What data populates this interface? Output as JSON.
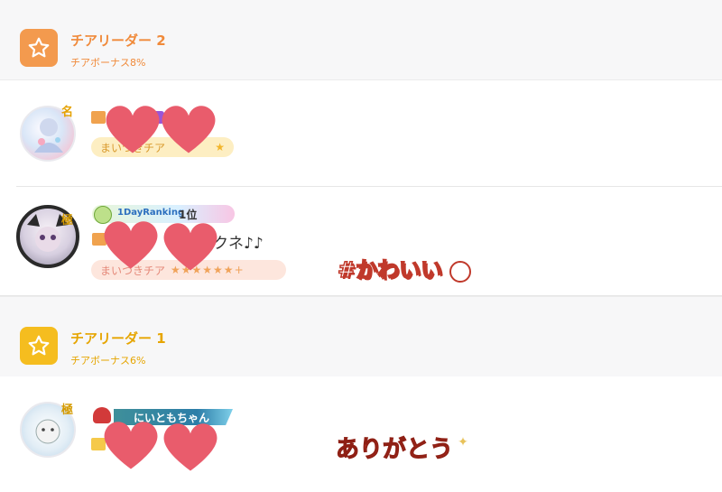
{
  "colors": {
    "tier2_accent": "#f39a4e",
    "tier1_accent": "#f5bd1f",
    "heart": "#e95c6c",
    "sticker_red": "#c0392b"
  },
  "section_tier2": {
    "title": "チアリーダー 2",
    "subtitle": "チアボーナス8%",
    "icon": "star-icon"
  },
  "section_tier1": {
    "title": "チアリーダー 1",
    "subtitle": "チアボーナス6%",
    "icon": "star-icon"
  },
  "rows": [
    {
      "rank_mark": "名",
      "pill_text": "まいつきチア"
    },
    {
      "rank_mark": "極",
      "ranking_badge": "1DayRanking",
      "ranking_pos": "1位",
      "name_fragment": "クネ♪♪",
      "pill_text": "まいつきチア"
    },
    {
      "rank_mark": "極",
      "banner_text": "にいともちゃん"
    }
  ],
  "stickers": {
    "kawaii": "#かわいい",
    "arigatou": "ありがとう"
  }
}
